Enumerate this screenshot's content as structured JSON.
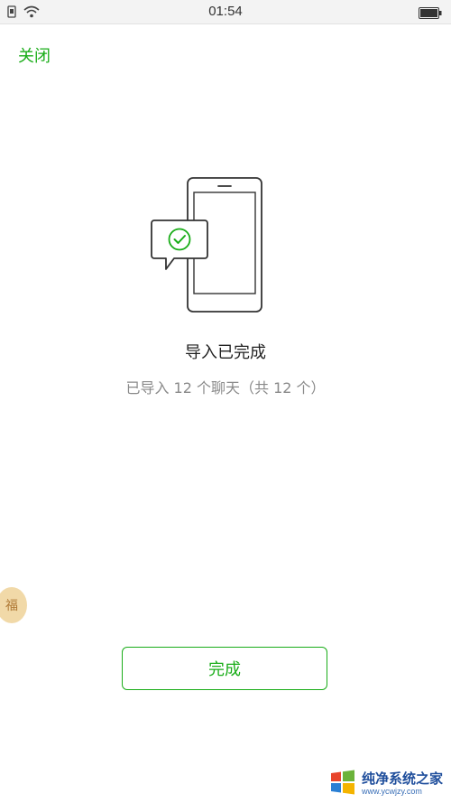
{
  "status_bar": {
    "time": "01:54"
  },
  "header": {
    "close_label": "关闭"
  },
  "result": {
    "title": "导入已完成",
    "subtitle": "已导入 12 个聊天（共 12 个）"
  },
  "sticker": {
    "label": "福"
  },
  "actions": {
    "done_label": "完成"
  },
  "watermark": {
    "title": "纯净系统之家",
    "url": "www.ycwjzy.com"
  },
  "colors": {
    "accent": "#1aad19",
    "text_secondary": "#8a8a8a",
    "watermark_blue": "#1f4e9c"
  },
  "icons": [
    "sim-icon",
    "wifi-icon",
    "battery-icon",
    "phone-icon",
    "chat-bubble-icon",
    "check-icon"
  ]
}
